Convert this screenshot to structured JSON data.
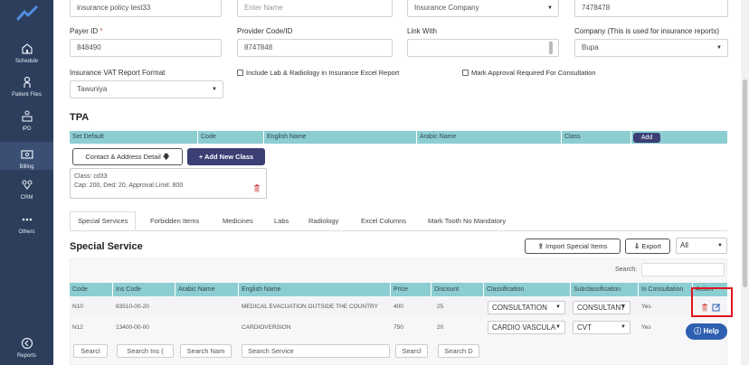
{
  "sidebar": {
    "items": [
      {
        "label": "Schedule",
        "icon": "home-icon"
      },
      {
        "label": "Patient Files",
        "icon": "patient-icon"
      },
      {
        "label": "IPD",
        "icon": "bed-icon"
      },
      {
        "label": "Billing",
        "icon": "billing-icon"
      },
      {
        "label": "CRM",
        "icon": "crm-icon"
      },
      {
        "label": "Others",
        "icon": "more-icon"
      },
      {
        "label": "Reports",
        "icon": "reports-icon"
      }
    ]
  },
  "form": {
    "policy_name_value": "insurance policy test33",
    "name_placeholder": "Enter Name",
    "company_select": "Insurance Company",
    "phone_value": "7478478",
    "payer_id_label": "Payer ID",
    "payer_id_required": "*",
    "payer_id_value": "848490",
    "provider_code_label": "Provider Code/ID",
    "provider_code_value": "8747848",
    "link_with_label": "Link With",
    "link_with_value": "",
    "company_label": "Company (This is used for insurance reports)",
    "company_value": "Bupa",
    "vat_format_label": "Insurance VAT Report Format",
    "vat_format_value": "Tawuniya",
    "include_lab_label": "Include Lab & Radiology in Insurance Excel Report",
    "mark_approval_label": "Mark Approval Required For Consultation"
  },
  "tpa": {
    "title": "TPA",
    "columns": [
      "Set Default",
      "Code",
      "English Name",
      "Arabic Name",
      "Class"
    ],
    "add_label": "Add",
    "contact_button": "Contact & Address Detail",
    "add_class_button": "+ Add New Class",
    "class_card": {
      "line1": "Class: cd33",
      "line2": "Cap: 200, Ded: 20, Approval Limit: 800"
    }
  },
  "tabs": [
    "Special Services",
    "Forbidden Items",
    "Medicines",
    "Labs",
    "Radiology",
    "Excel Columns",
    "Mark Tooth No Mandatory"
  ],
  "special_service": {
    "title": "Special Service",
    "import_button": "Import Special Items",
    "export_button": "Export",
    "filter_select": "All",
    "search_label": "Search:",
    "columns": [
      "Code",
      "Ins Code",
      "Arabic Name",
      "English Name",
      "Price",
      "Discount",
      "Classification",
      "Subclassification",
      "Is Consultation",
      "Action"
    ],
    "rows": [
      {
        "code": "N10",
        "ins_code": "83510-00-20",
        "arabic_name": "",
        "english_name": "MEDICAL EVACUATION OUTSIDE THE COUNTRY",
        "price": "400",
        "discount": "25",
        "classification": "CONSULTATION",
        "subclassification": "CONSULTANT",
        "is_consultation": "Yes"
      },
      {
        "code": "N12",
        "ins_code": "13400-00-00",
        "arabic_name": "",
        "english_name": "CARDIOVERSION",
        "price": "750",
        "discount": "20",
        "classification": "CARDIO VASCULA",
        "subclassification": "CVT",
        "is_consultation": "Yes"
      }
    ],
    "filters": [
      "Searcl",
      "Search Ins (",
      "Search Nam",
      "Search Service",
      "Searcl",
      "Search D"
    ]
  },
  "help_label": "Help",
  "colors": {
    "sidebar": "#2c3e5c",
    "table_header": "#8ccdd2",
    "primary_button": "#3b3f74",
    "highlight": "#e0141e",
    "help": "#2f5fb0"
  }
}
